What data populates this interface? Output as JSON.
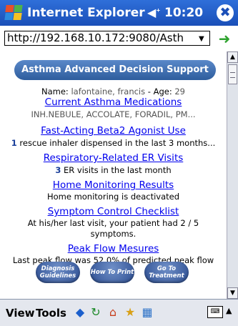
{
  "titlebar": {
    "title": "Internet Explorer",
    "volume_icon": "speaker-icon",
    "time": "10:20",
    "close_label": "✖"
  },
  "address": {
    "url": "http://192.168.10.172:9080/Asth",
    "dropdown_icon": "chevron-down-icon",
    "go_icon": "go-arrow-icon"
  },
  "page": {
    "banner": "Asthma Advanced Decision Support",
    "name_label": "Name:",
    "name_value": "lafontaine, francis",
    "age_label": "- Age:",
    "age_value": "29",
    "meds_link": "Current Asthma Medications",
    "meds_text": "INH.NEBULE, ACCOLATE, FORADIL, PM...",
    "beta_link": "Fast-Acting Beta2 Agonist Use",
    "beta_count": "1",
    "beta_text": "rescue inhaler dispensed in the last 3 months...",
    "er_link": "Respiratory-Related ER Visits",
    "er_count": "3",
    "er_text": "ER visits in the last month",
    "home_link": "Home Monitoring Results",
    "home_text": "Home monitoring is deactivated",
    "symptom_link": "Symptom Control Checklist",
    "symptom_text_1": "At his/her last visit, your patient had 2 / 5",
    "symptom_text_2": "symptoms.",
    "peak_link": "Peak Flow Mesures",
    "peak_text": "Last peak flow was 52.0% of predicted peak flow",
    "buttons": [
      "Diagnosis Guidelines",
      "How To Print",
      "Go To Treatment"
    ]
  },
  "bottombar": {
    "view": "View",
    "tools": "Tools",
    "icons": [
      "back-icon",
      "refresh-icon",
      "home-icon",
      "favorites-icon",
      "history-icon"
    ],
    "keyboard_icon": "keyboard-icon"
  }
}
